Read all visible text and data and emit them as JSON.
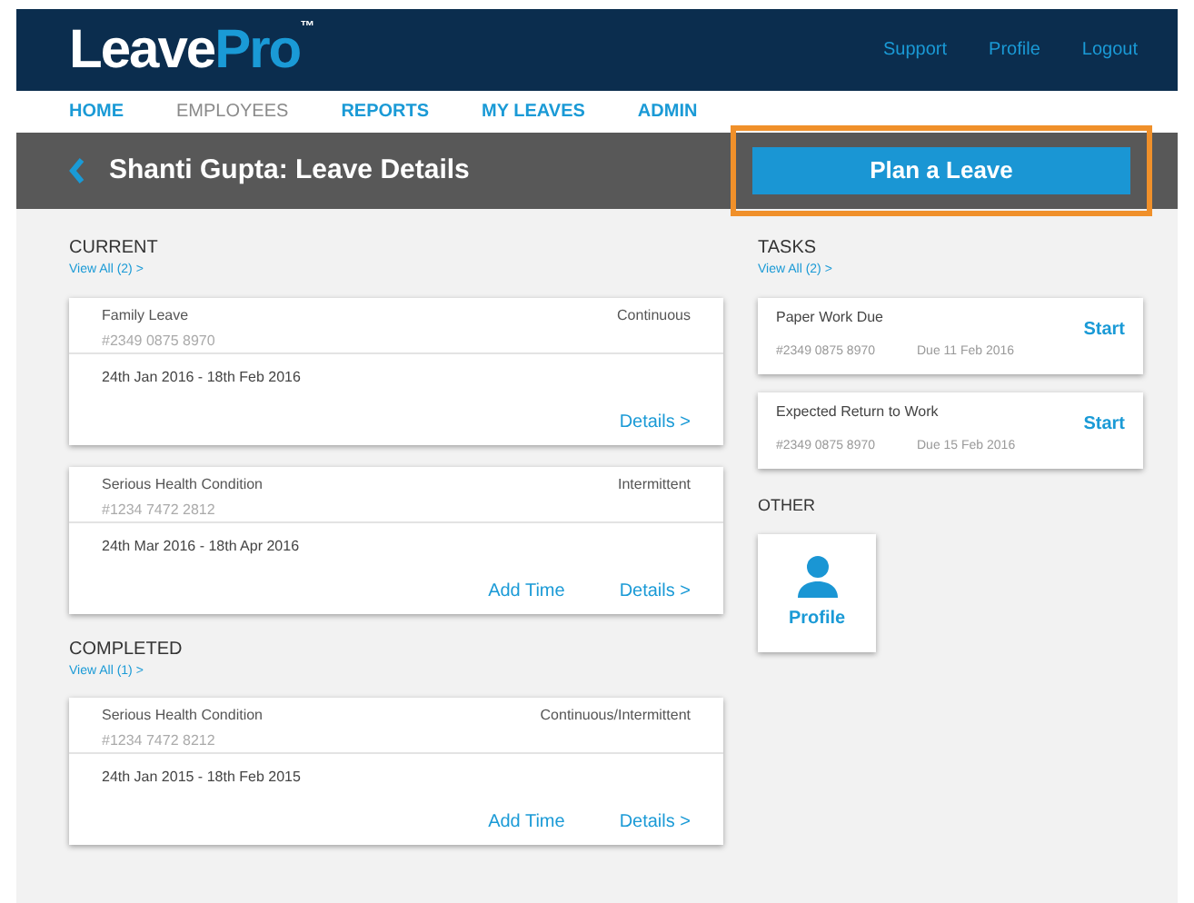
{
  "header": {
    "logo": {
      "main": "Leave",
      "accent": "Pro",
      "mark": "™"
    },
    "links": [
      "Support",
      "Profile",
      "Logout"
    ]
  },
  "nav": [
    {
      "label": "HOME",
      "selected": false
    },
    {
      "label": "EMPLOYEES",
      "selected": true
    },
    {
      "label": "REPORTS",
      "selected": false
    },
    {
      "label": "MY LEAVES",
      "selected": false
    },
    {
      "label": "ADMIN",
      "selected": false
    }
  ],
  "title_bar": {
    "title": "Shanti Gupta: Leave Details",
    "button": "Plan a Leave",
    "highlighted": true
  },
  "sections": [
    {
      "heading": "CURRENT",
      "view_all": "View All (2) >",
      "leaves": [
        {
          "name": "Family Leave",
          "number": "#2349 0875 8970",
          "type": "Continuous",
          "dates": "24th Jan 2016 - 18th Feb 2016",
          "actions": [
            "Details >"
          ]
        },
        {
          "name": "Serious Health Condition",
          "number": "#1234 7472 2812",
          "type": "Intermittent",
          "dates": "24th Mar 2016 - 18th Apr 2016",
          "actions": [
            "Add Time",
            "Details >"
          ]
        }
      ]
    },
    {
      "heading": "COMPLETED",
      "view_all": "View All (1) >",
      "leaves": [
        {
          "name": "Serious Health Condition",
          "number": "#1234 7472 8212",
          "type": "Continuous/Intermittent",
          "dates": "24th Jan 2015 - 18th Feb 2015",
          "actions": [
            "Add Time",
            "Details >"
          ]
        }
      ]
    }
  ],
  "tasks": {
    "heading": "TASKS",
    "view_all": "View All (2) >",
    "items": [
      {
        "title": "Paper Work Due",
        "number": "#2349 0875 8970",
        "due": "Due 11 Feb 2016",
        "action": "Start"
      },
      {
        "title": "Expected Return to Work",
        "number": "#2349 0875 8970",
        "due": "Due 15 Feb 2016",
        "action": "Start"
      }
    ]
  },
  "other": {
    "heading": "OTHER",
    "tiles": [
      {
        "label": "Profile"
      }
    ]
  }
}
